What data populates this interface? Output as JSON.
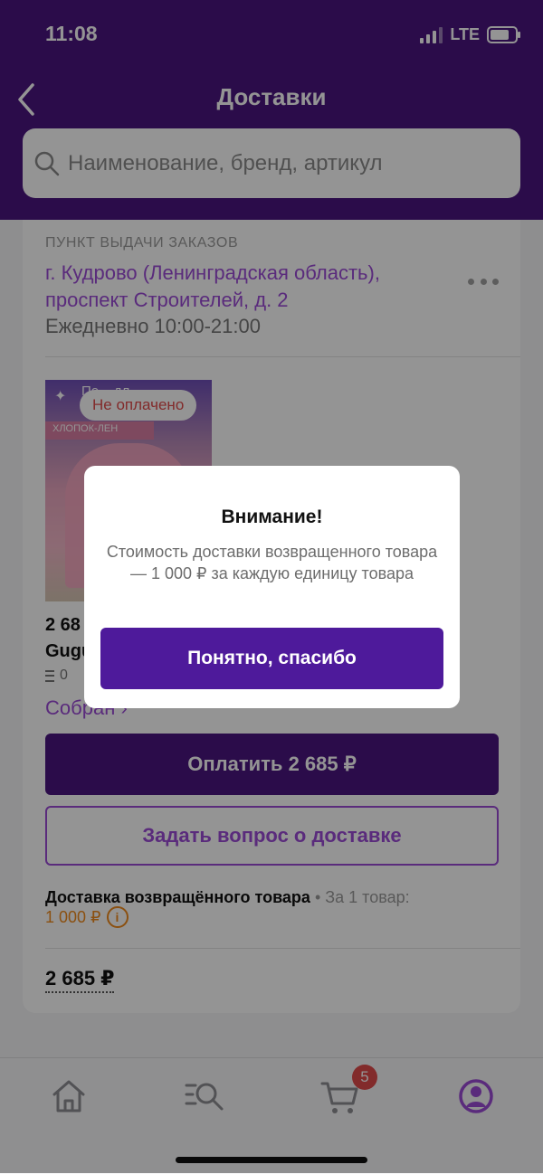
{
  "status_bar": {
    "time": "11:08",
    "network": "LTE"
  },
  "header": {
    "title": "Доставки"
  },
  "search": {
    "placeholder": "Наименование, бренд, артикул"
  },
  "pickup": {
    "label": "ПУНКТ ВЫДАЧИ ЗАКАЗОВ",
    "address": "г. Кудрово (Ленинградская область), проспект Строителей, д. 2",
    "hours": "Ежедневно 10:00-21:00"
  },
  "product": {
    "badge": "Не оплачено",
    "image_text_top": "По... дл...",
    "image_text_strip": "ХЛОПОК-ЛЕН",
    "price_partial": "2 68",
    "name_partial": "Gugu",
    "qty": "0",
    "status": "Собран ›"
  },
  "actions": {
    "pay_label": "Оплатить 2 685 ₽",
    "ask_label": "Задать вопрос о доставке"
  },
  "return_delivery": {
    "title": "Доставка возвращённого товара",
    "separator": " • ",
    "per_item": "За 1 товар:",
    "price": "1 000 ₽",
    "info_icon": "i"
  },
  "total": "2 685 ₽",
  "tab_bar": {
    "cart_count": "5",
    "icons": [
      "home-icon",
      "catalog-search-icon",
      "cart-icon",
      "profile-icon"
    ],
    "accent": "#9b4bd6"
  },
  "modal": {
    "title": "Внимание!",
    "text": "Стоимость доставки возвращенного товара — 1 000 ₽ за каждую единицу товара",
    "button": "Понятно, спасибо"
  },
  "colors": {
    "brand": "#4a1580",
    "accent": "#9b4bd6",
    "warning": "#f08a1c",
    "danger": "#e14a4a"
  }
}
